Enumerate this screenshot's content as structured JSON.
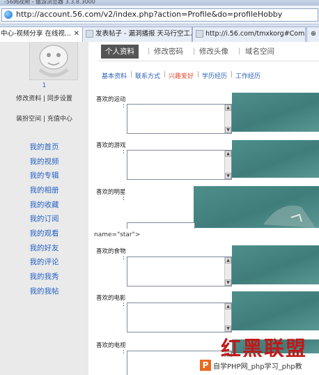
{
  "window": {
    "title": "-56网视频 - 傲游浏览器 3.3.8.3000"
  },
  "address_bar": {
    "url": "http://account.56.com/v2/index.php?action=Profile&do=profileHobby"
  },
  "browser_tabs": [
    {
      "label": "中心-视频分享 在线视...",
      "close": "✕"
    },
    {
      "label": "发表帖子 - 漏洞播报 天马行空工..."
    },
    {
      "label": "http://i.56.com/tmxkorg#Commen..."
    },
    {
      "label": "⊕"
    }
  ],
  "sidebar": {
    "user_id": "1",
    "links_row1": "修改资料 | 同步设置",
    "links_row2": "装扮空间 | 充值中心",
    "items": [
      "我的首页",
      "我的视频",
      "我的专辑",
      "我的相册",
      "我的收藏",
      "我的订阅",
      "我的观看",
      "我的好友",
      "我的评论",
      "我的我秀",
      "我的我帖"
    ]
  },
  "main": {
    "tabs": [
      "个人资料",
      "修改密码",
      "修改头像",
      "域名空间"
    ],
    "subtabs": [
      "基本资料",
      "联系方式",
      "兴趣爱好",
      "学历经历",
      "工作经历"
    ],
    "fields": [
      {
        "label": "喜欢的运动",
        "colon": ":"
      },
      {
        "label": "喜欢的游戏",
        "colon": ":"
      },
      {
        "label": "喜欢的明星",
        "colon": ":"
      },
      {
        "label": "喜欢的食物",
        "colon": ":"
      },
      {
        "label": "喜欢的电影",
        "colon": ":"
      },
      {
        "label": "喜欢的电视",
        "colon": ":"
      }
    ],
    "leaked_text": "name=\"star\">"
  },
  "watermark": {
    "big": "红黑联盟",
    "php_icon": "P",
    "php_text": "自学PHP网_php学习_php教"
  },
  "icons": {
    "browser": "ie-globe-icon",
    "scroll_up": "▲",
    "scroll_down": "▼"
  }
}
